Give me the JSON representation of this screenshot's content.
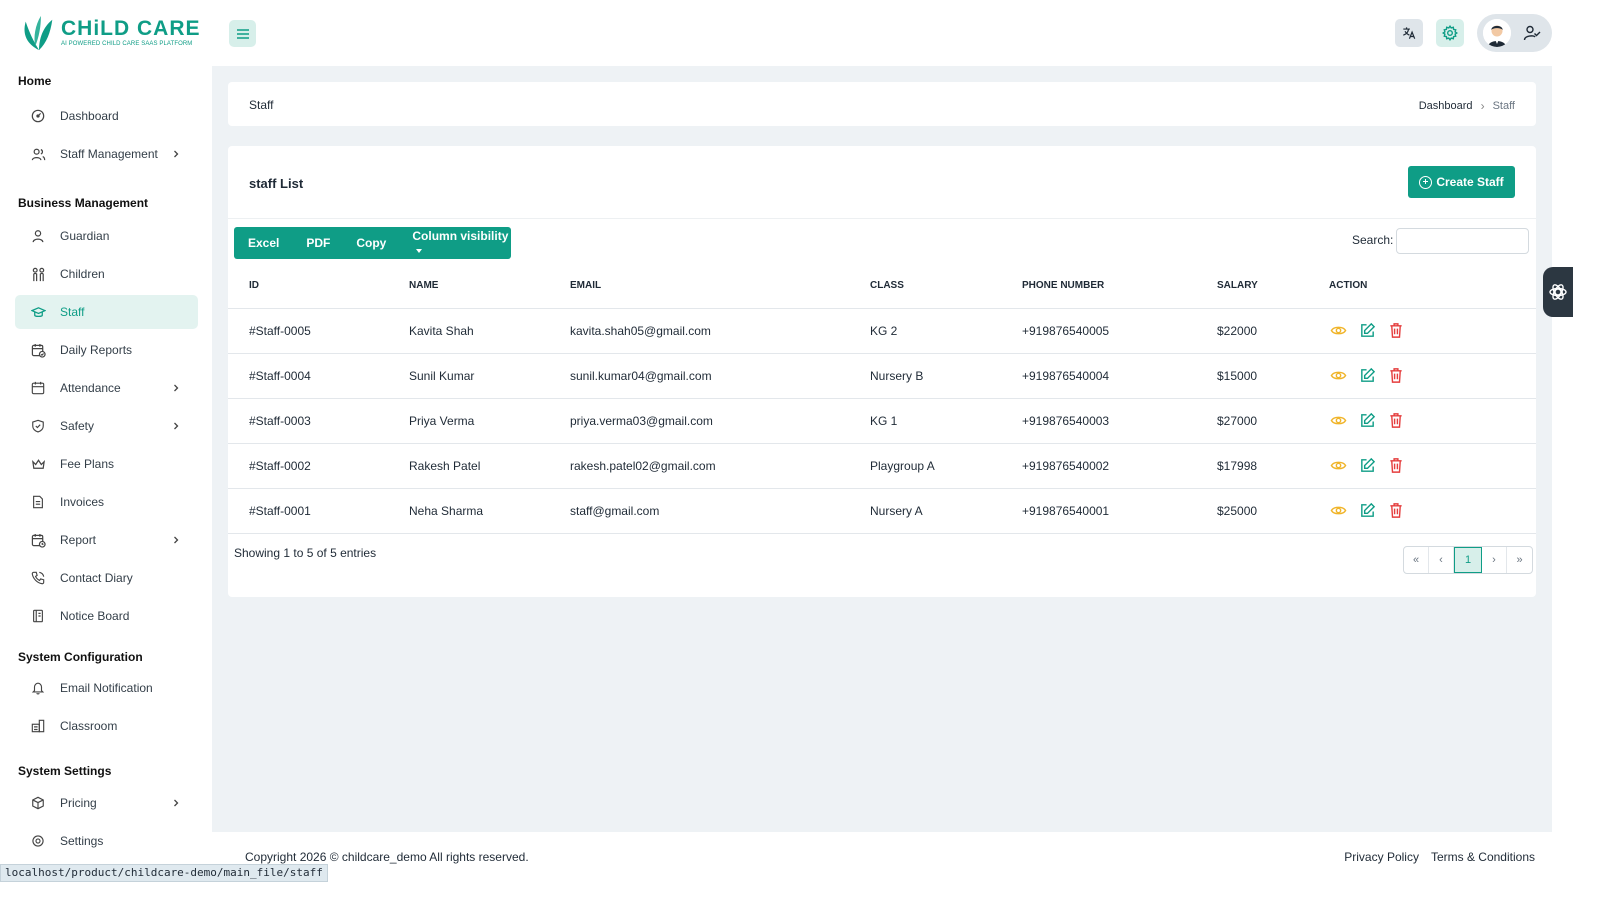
{
  "brand": {
    "title": "CHiLD CARE",
    "subtitle": "AI POWERED CHILD CARE SAAS PLATFORM",
    "accent_color": "#0f9d86"
  },
  "sidebar": {
    "groups": [
      {
        "label": "Home",
        "items": [
          {
            "label": "Dashboard",
            "icon": "dashboard-icon"
          },
          {
            "label": "Staff Management",
            "icon": "users-icon",
            "has_submenu": true
          }
        ]
      },
      {
        "label": "Business Management",
        "items": [
          {
            "label": "Guardian",
            "icon": "user-icon"
          },
          {
            "label": "Children",
            "icon": "children-icon"
          },
          {
            "label": "Staff",
            "icon": "graduation-cap-icon",
            "active": true
          },
          {
            "label": "Daily Reports",
            "icon": "calendar-check-icon"
          },
          {
            "label": "Attendance",
            "icon": "calendar-icon",
            "has_submenu": true
          },
          {
            "label": "Safety",
            "icon": "shield-icon",
            "has_submenu": true
          },
          {
            "label": "Fee Plans",
            "icon": "crown-icon"
          },
          {
            "label": "Invoices",
            "icon": "invoice-icon"
          },
          {
            "label": "Report",
            "icon": "report-icon",
            "has_submenu": true
          },
          {
            "label": "Contact Diary",
            "icon": "phone-icon"
          },
          {
            "label": "Notice Board",
            "icon": "notice-icon"
          }
        ]
      },
      {
        "label": "System Configuration",
        "items": [
          {
            "label": "Email Notification",
            "icon": "bell-icon"
          },
          {
            "label": "Classroom",
            "icon": "classroom-icon"
          }
        ]
      },
      {
        "label": "System Settings",
        "items": [
          {
            "label": "Pricing",
            "icon": "box-icon",
            "has_submenu": true
          },
          {
            "label": "Settings",
            "icon": "settings-icon"
          }
        ]
      }
    ]
  },
  "header": {
    "menu_icon": "hamburger-icon",
    "language_icon": "translate-icon",
    "settings_icon": "gear-icon",
    "profile_icon": "user-check-icon"
  },
  "breadcrumb_card": {
    "title": "Staff",
    "crumbs": [
      "Dashboard",
      "Staff"
    ]
  },
  "staff_list": {
    "title": "staff List",
    "create_button": "Create Staff",
    "export_buttons": [
      "Excel",
      "PDF",
      "Copy",
      "Column visibility"
    ],
    "search_label": "Search:",
    "search_value": "",
    "columns": [
      "ID",
      "NAME",
      "EMAIL",
      "CLASS",
      "PHONE NUMBER",
      "SALARY",
      "ACTION"
    ],
    "rows": [
      {
        "id": "#Staff-0005",
        "name": "Kavita Shah",
        "email": "kavita.shah05@gmail.com",
        "class": "KG 2",
        "phone": "+919876540005",
        "salary": "$22000"
      },
      {
        "id": "#Staff-0004",
        "name": "Sunil Kumar",
        "email": "sunil.kumar04@gmail.com",
        "class": "Nursery B",
        "phone": "+919876540004",
        "salary": "$15000"
      },
      {
        "id": "#Staff-0003",
        "name": "Priya Verma",
        "email": "priya.verma03@gmail.com",
        "class": "KG 1",
        "phone": "+919876540003",
        "salary": "$27000"
      },
      {
        "id": "#Staff-0002",
        "name": "Rakesh Patel",
        "email": "rakesh.patel02@gmail.com",
        "class": "Playgroup A",
        "phone": "+919876540002",
        "salary": "$17998"
      },
      {
        "id": "#Staff-0001",
        "name": "Neha Sharma",
        "email": "staff@gmail.com",
        "class": "Nursery A",
        "phone": "+919876540001",
        "salary": "$25000"
      }
    ],
    "action_colors": {
      "view": "#f0b429",
      "edit": "#0f9d86",
      "delete": "#e53e3e"
    },
    "entries_text": "Showing 1 to 5 of 5 entries",
    "pagination": [
      "«",
      "‹",
      "1",
      "›",
      "»"
    ],
    "current_page": "1"
  },
  "footer": {
    "copyright": "Copyright 2026 © childcare_demo All rights reserved.",
    "links": [
      "Privacy Policy",
      "Terms & Conditions"
    ]
  },
  "status_url": "localhost/product/childcare-demo/main_file/staff"
}
